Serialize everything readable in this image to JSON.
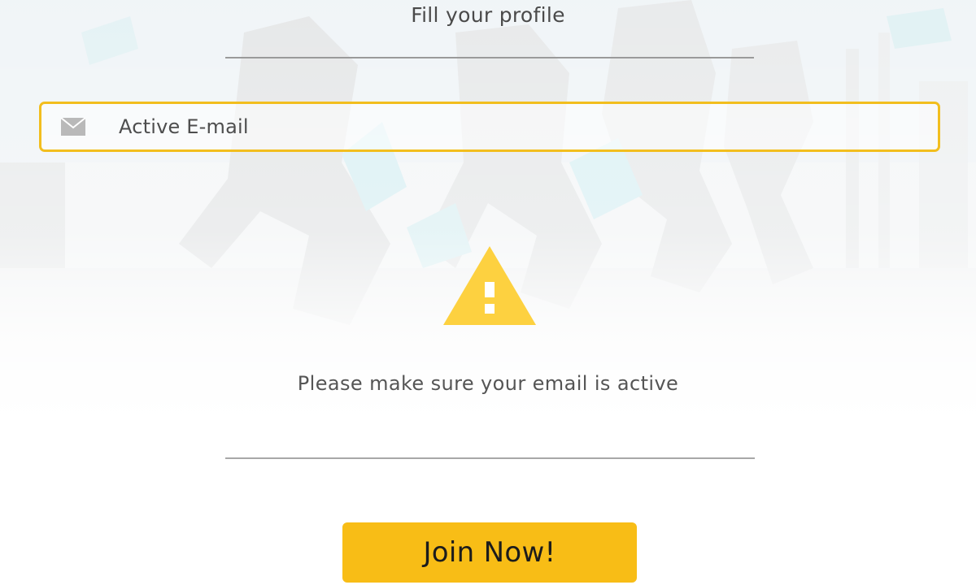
{
  "header": {
    "title": "Fill your profile"
  },
  "form": {
    "email_placeholder": "Active E-mail",
    "email_icon": "mail-icon"
  },
  "notice": {
    "icon": "warning-icon",
    "text": "Please make sure your email is active"
  },
  "actions": {
    "join_label": "Join Now!"
  },
  "colors": {
    "accent": "#f8bd16",
    "field_border": "#f2be1e",
    "warning": "#fdd140",
    "text": "#4e4e4e"
  }
}
